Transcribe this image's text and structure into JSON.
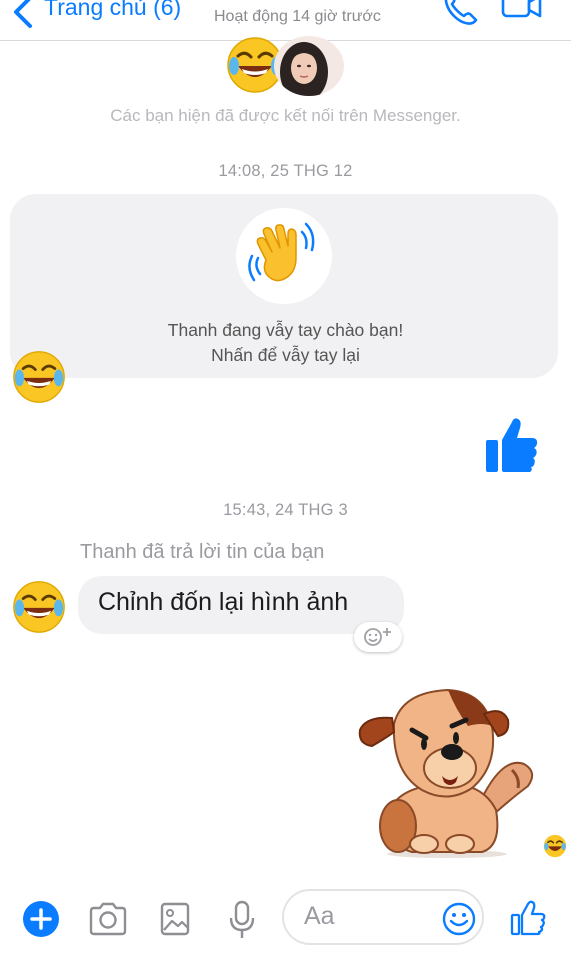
{
  "header": {
    "back_label": "Trang chủ (6)",
    "status": "Hoạt động 14 giờ trước"
  },
  "conversation": {
    "connected_notice": "Các bạn hiện đã được kết nối trên Messenger.",
    "timestamps": [
      "14:08, 25 THG 12",
      "15:43, 24 THG 3"
    ],
    "wave_card": {
      "line1": "Thanh đang vẫy tay chào bạn!",
      "line2": "Nhấn để vẫy tay lại"
    },
    "reply_note": "Thanh đã trả lời tin của bạn",
    "message_text": "Chỉnh đốn lại hình ảnh"
  },
  "composer": {
    "placeholder": "Aa"
  },
  "colors": {
    "accent": "#0a7cff",
    "bubble_bg": "#f1f1f3",
    "meta_text": "#9a9aa0"
  },
  "icons": [
    "back-chevron-icon",
    "phone-icon",
    "video-icon",
    "laughing-emoji-icon",
    "waving-hand-icon",
    "thumbs-up-icon",
    "add-reaction-icon",
    "dog-sticker",
    "plus-icon",
    "camera-icon",
    "image-icon",
    "microphone-icon",
    "smiley-icon"
  ]
}
